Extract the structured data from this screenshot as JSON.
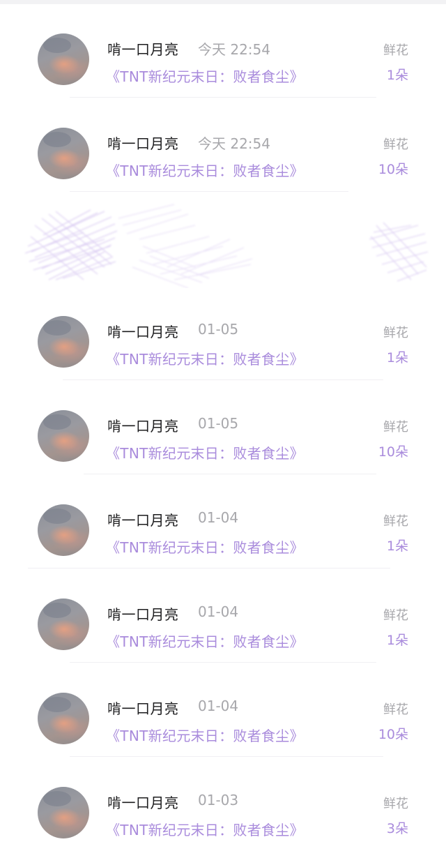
{
  "list": {
    "rows": [
      {
        "user": "啃一口月亮",
        "time": "今天 22:54",
        "book": "《TNT新纪元末日：败者食尘》",
        "gift_label": "鲜花",
        "gift_count": "1朵"
      },
      {
        "user": "啃一口月亮",
        "time": "今天 22:54",
        "book": "《TNT新纪元末日：败者食尘》",
        "gift_label": "鲜花",
        "gift_count": "10朵"
      },
      {
        "user": "啃一口月亮",
        "time": "01-05",
        "book": "《TNT新纪元末日：败者食尘》",
        "gift_label": "鲜花",
        "gift_count": "1朵"
      },
      {
        "user": "啃一口月亮",
        "time": "01-05",
        "book": "《TNT新纪元末日：败者食尘》",
        "gift_label": "鲜花",
        "gift_count": "10朵"
      },
      {
        "user": "啃一口月亮",
        "time": "01-04",
        "book": "《TNT新纪元末日：败者食尘》",
        "gift_label": "鲜花",
        "gift_count": "1朵"
      },
      {
        "user": "啃一口月亮",
        "time": "01-04",
        "book": "《TNT新纪元末日：败者食尘》",
        "gift_label": "鲜花",
        "gift_count": "1朵"
      },
      {
        "user": "啃一口月亮",
        "time": "01-04",
        "book": "《TNT新纪元末日：败者食尘》",
        "gift_label": "鲜花",
        "gift_count": "10朵"
      },
      {
        "user": "啃一口月亮",
        "time": "01-03",
        "book": "《TNT新纪元末日：败者食尘》",
        "gift_label": "鲜花",
        "gift_count": "3朵"
      }
    ]
  },
  "colors": {
    "name": "#1c1c1e",
    "muted": "#a7a7ab",
    "accent": "#a98bdc",
    "scribble": "#b79be6"
  },
  "icons": {
    "avatar": "user-avatar-photo",
    "redaction": "purple-scribble-redaction"
  }
}
